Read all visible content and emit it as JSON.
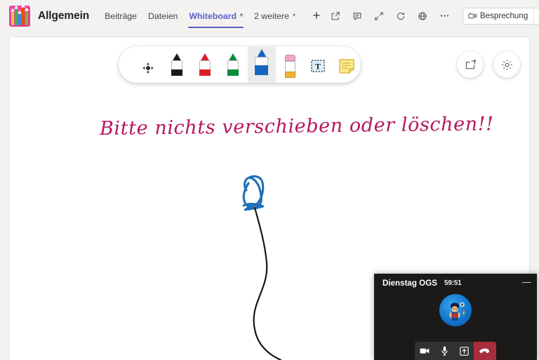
{
  "app": {
    "team_name": "Allgemein",
    "team_icon": "colored-pencils-icon"
  },
  "tabs": [
    {
      "label": "Beiträge",
      "active": false,
      "has_chevron": false
    },
    {
      "label": "Dateien",
      "active": false,
      "has_chevron": false
    },
    {
      "label": "Whiteboard",
      "active": true,
      "has_chevron": true
    },
    {
      "label": "2 weitere",
      "active": false,
      "has_chevron": true
    }
  ],
  "tab_add_label": "+",
  "top_right": {
    "icons": [
      "open-in-new-window-icon",
      "chat-icon",
      "expand-icon",
      "refresh-icon",
      "globe-icon",
      "more-options-icon"
    ],
    "meeting_button_label": "Besprechung",
    "meeting_button_icon": "video-camera-icon",
    "meeting_dropdown_icon": "chevron-down-icon"
  },
  "whiteboard": {
    "toolbar": [
      {
        "name": "move-tool",
        "label": "Verschieben",
        "selected": false,
        "type": "move"
      },
      {
        "name": "pen-black",
        "label": "Stift schwarz",
        "selected": false,
        "type": "pen",
        "color": "#1a1a1a"
      },
      {
        "name": "pen-red",
        "label": "Stift rot",
        "selected": false,
        "type": "pen",
        "color": "#d91f26"
      },
      {
        "name": "pen-green",
        "label": "Stift grün",
        "selected": false,
        "type": "pen",
        "color": "#0d8a3e"
      },
      {
        "name": "pen-blue",
        "label": "Stift blau",
        "selected": true,
        "type": "pen",
        "color": "#1565c0"
      },
      {
        "name": "eraser-tool",
        "label": "Radiergummi",
        "selected": false,
        "type": "eraser"
      },
      {
        "name": "text-tool",
        "label": "Text",
        "selected": false,
        "type": "text"
      },
      {
        "name": "sticky-note-tool",
        "label": "Notizzettel",
        "selected": false,
        "type": "note"
      }
    ],
    "right_buttons": [
      {
        "name": "share-board-button",
        "icon": "share-board-icon"
      },
      {
        "name": "settings-button",
        "icon": "gear-icon"
      }
    ],
    "title_text": "Bitte nichts verschieben oder löschen!!",
    "title_color": "#b5185e",
    "drawings": [
      {
        "name": "balloon-drawing",
        "color": "#1f6fb8"
      },
      {
        "name": "balloon-string-drawing",
        "color": "#171717"
      }
    ]
  },
  "call": {
    "title": "Dienstag OGS",
    "timer": "59:51",
    "minimize_label": "—",
    "avatar_alt": "Benutzerbild",
    "controls": [
      {
        "name": "camera-button",
        "icon": "video-camera-icon"
      },
      {
        "name": "microphone-button",
        "icon": "microphone-icon"
      },
      {
        "name": "share-screen-button",
        "icon": "share-screen-icon"
      },
      {
        "name": "hang-up-button",
        "icon": "phone-hangup-icon",
        "color": "#a82d3c"
      }
    ]
  }
}
